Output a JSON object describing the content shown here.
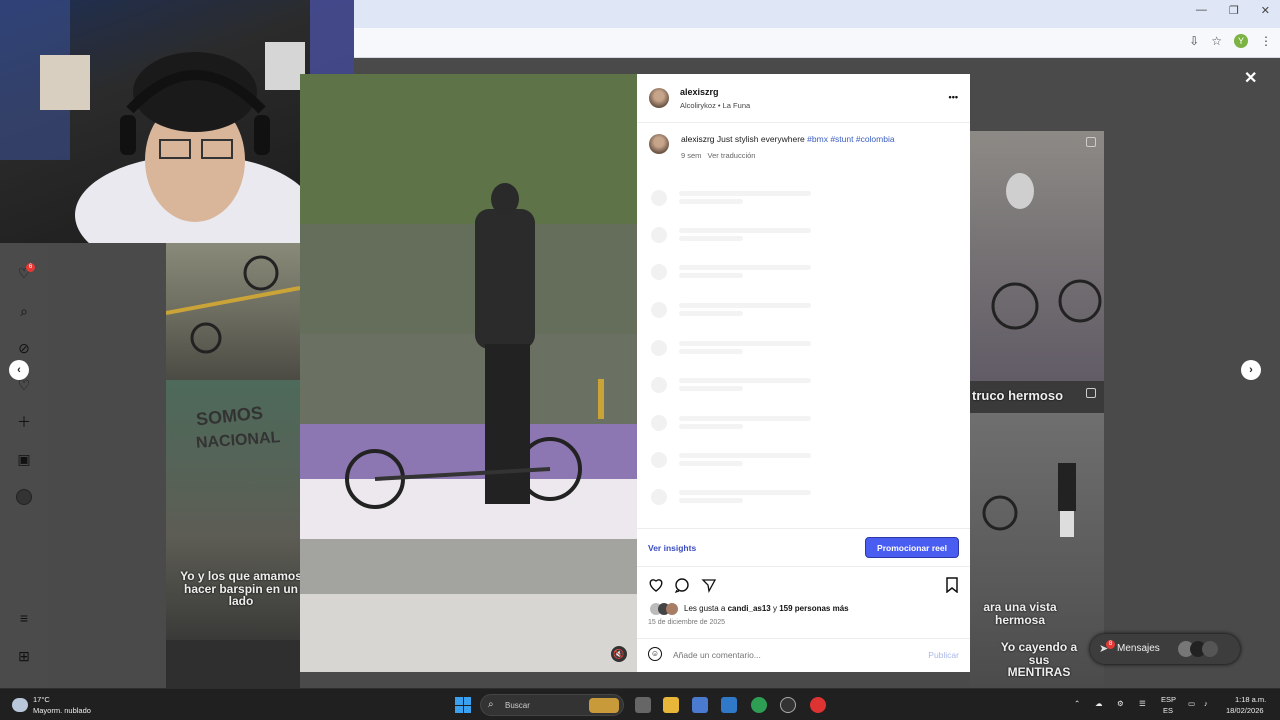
{
  "browser": {
    "window_controls": [
      "—",
      "❐",
      "✕"
    ],
    "profile_initial": "Y"
  },
  "sidebar": {
    "notification_count": "6",
    "icons": [
      "heart-icon",
      "search-icon",
      "compass-icon",
      "heart-outline-icon",
      "plus-icon",
      "chart-icon",
      "avatar-icon",
      "menu-icon",
      "grid-icon"
    ]
  },
  "background": {
    "caption_left": "Yo y los que amamos hacer barspin en un lado",
    "caption_right_1": "truco hermoso",
    "caption_right_2": "ara una vista hermosa",
    "caption_right_3": "Yo cayendo a sus MENTIRAS"
  },
  "post": {
    "username": "alexiszrg",
    "audio_location": "Alcolirykoz • La Funa",
    "caption_user": "alexiszrg",
    "caption_text": "Just stylish everywhere",
    "hashtags": "#bmx #stunt #colombia",
    "age": "9 sem",
    "translate_label": "Ver traducción",
    "insights_label": "Ver insights",
    "promote_label": "Promocionar reel",
    "likes_prefix": "Les gusta a",
    "likes_user": "candi_as13",
    "likes_mid": "y",
    "likes_count": "159 personas más",
    "date": "15 de diciembre de 2025",
    "comment_placeholder": "Añade un comentario...",
    "publish_label": "Publicar",
    "more_label": "•••"
  },
  "messages": {
    "label": "Mensajes",
    "badge": "8"
  },
  "taskbar": {
    "weather_temp": "17°C",
    "weather_desc": "Mayorm. nublado",
    "search_placeholder": "Buscar",
    "lang_1": "ESP",
    "lang_2": "ES",
    "time": "1:18 a.m.",
    "date": "18/02/2026"
  },
  "colors": {
    "promote_button": "#4a5df1",
    "link": "#3b5ec2",
    "badge": "#e53935"
  }
}
